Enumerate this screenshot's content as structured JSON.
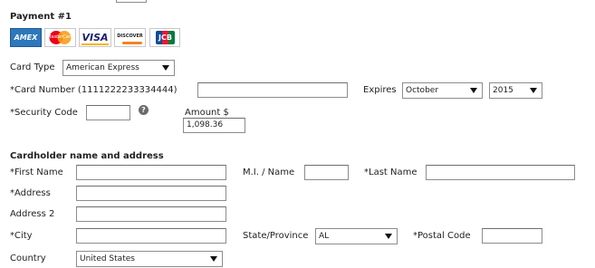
{
  "section_payment": {
    "title": "Payment #1"
  },
  "card_logos": [
    {
      "name": "AMEX"
    },
    {
      "name": "MasterCard"
    },
    {
      "name": "VISA"
    },
    {
      "name": "DISCOVER"
    },
    {
      "name": "JCB"
    }
  ],
  "payment": {
    "card_type_label": "Card Type",
    "card_type_value": "American Express",
    "card_number_label": "*Card Number (1111222233334444)",
    "card_number_value": "",
    "expires_label": "Expires",
    "expires_month": "October",
    "expires_year": "2015",
    "security_code_label": "*Security Code",
    "security_code_value": "",
    "amount_label": "Amount $",
    "amount_value": "1,098.36"
  },
  "cardholder": {
    "title": "Cardholder name and address",
    "first_name_label": "*First Name",
    "first_name_value": "",
    "mi_label": "M.I. / Name",
    "mi_value": "",
    "last_name_label": "*Last Name",
    "last_name_value": "",
    "address_label": "*Address",
    "address_value": "",
    "address2_label": "Address 2",
    "address2_value": "",
    "city_label": "*City",
    "city_value": "",
    "state_label": "State/Province",
    "state_value": "AL",
    "postal_label": "*Postal Code",
    "postal_value": "",
    "country_label": "Country",
    "country_value": "United States"
  },
  "colors": {
    "amex": "#2e77bc",
    "mastercard_red": "#eb001b",
    "mastercard_orange": "#f79e1b",
    "visa": "#1a1f71",
    "discover_orange": "#f58220",
    "jcb_blue": "#0e4c96",
    "jcb_red": "#e21836",
    "jcb_green": "#007b40"
  }
}
